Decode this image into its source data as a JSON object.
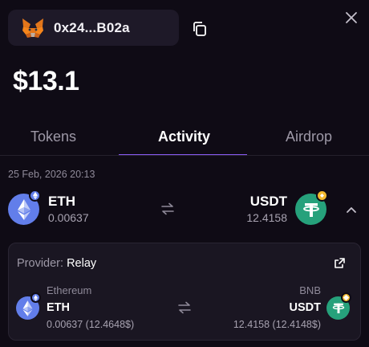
{
  "header": {
    "wallet_address": "0x24...B02a",
    "balance": "$13.1"
  },
  "tabs": [
    {
      "label": "Tokens",
      "active": false
    },
    {
      "label": "Activity",
      "active": true
    },
    {
      "label": "Airdrop",
      "active": false
    }
  ],
  "activity": {
    "date": "25 Feb, 2026 20:13",
    "from": {
      "symbol": "ETH",
      "amount": "0.00637"
    },
    "to": {
      "symbol": "USDT",
      "amount": "12.4158"
    },
    "details": {
      "provider_label": "Provider:",
      "provider_name": "Relay",
      "from_chain": "Ethereum",
      "from_symbol": "ETH",
      "from_amount": "0.00637",
      "from_value": "(12.4648$)",
      "to_chain": "BNB",
      "to_symbol": "USDT",
      "to_amount": "12.4158",
      "to_value": "(12.4148$)"
    }
  },
  "colors": {
    "background": "#0f0b15",
    "accent": "#8a5cf5",
    "eth": "#627eea",
    "usdt": "#26a17b",
    "bnb": "#f3ba2f"
  },
  "icons": [
    "metamask-fox-icon",
    "copy-icon",
    "close-icon",
    "swap-arrows-icon",
    "chevron-up-icon",
    "external-link-icon",
    "eth-icon",
    "usdt-icon",
    "bnb-icon"
  ]
}
